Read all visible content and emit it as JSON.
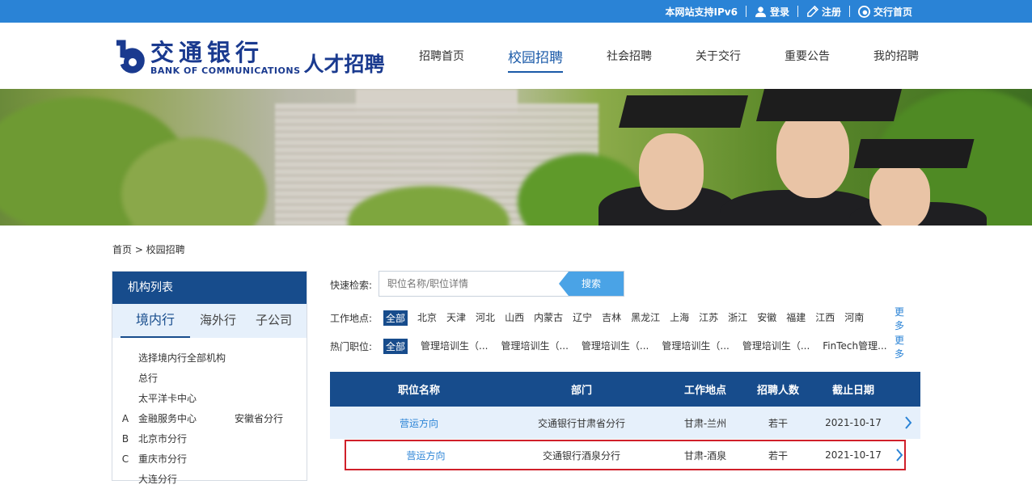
{
  "topbar": {
    "ipv6": "本网站支持IPv6",
    "login": "登录",
    "register": "注册",
    "home": "交行首页"
  },
  "logo": {
    "cn": "交通银行",
    "en": "BANK OF COMMUNICATIONS",
    "sub": "人才招聘"
  },
  "nav": [
    {
      "label": "招聘首页"
    },
    {
      "label": "校园招聘"
    },
    {
      "label": "社会招聘"
    },
    {
      "label": "关于交行"
    },
    {
      "label": "重要公告"
    },
    {
      "label": "我的招聘"
    }
  ],
  "breadcrumb": "首页 > 校园招聘",
  "sidebar": {
    "title": "机构列表",
    "tabs": [
      "境内行",
      "海外行",
      "子公司"
    ],
    "items": [
      {
        "letter": "",
        "name": "选择境内行全部机构",
        "extra": ""
      },
      {
        "letter": "",
        "name": "总行",
        "extra": ""
      },
      {
        "letter": "",
        "name": "太平洋卡中心",
        "extra": ""
      },
      {
        "letter": "A",
        "name": "金融服务中心",
        "extra": "安徽省分行"
      },
      {
        "letter": "B",
        "name": "北京市分行",
        "extra": ""
      },
      {
        "letter": "C",
        "name": "重庆市分行",
        "extra": ""
      },
      {
        "letter": "",
        "name": "大连分行",
        "extra": ""
      }
    ]
  },
  "search": {
    "label": "快速检索:",
    "placeholder": "职位名称/职位详情",
    "button": "搜索"
  },
  "filters": {
    "location_label": "工作地点:",
    "locations": [
      "全部",
      "北京",
      "天津",
      "河北",
      "山西",
      "内蒙古",
      "辽宁",
      "吉林",
      "黑龙江",
      "上海",
      "江苏",
      "浙江",
      "安徽",
      "福建",
      "江西",
      "河南"
    ],
    "position_label": "热门职位:",
    "positions": [
      "全部",
      "管理培训生（...",
      "管理培训生（...",
      "管理培训生（...",
      "管理培训生（...",
      "管理培训生（...",
      "FinTech管理..."
    ],
    "more": "更多"
  },
  "table": {
    "headers": [
      "职位名称",
      "部门",
      "工作地点",
      "招聘人数",
      "截止日期"
    ],
    "rows": [
      [
        "营运方向",
        "交通银行甘肃省分行",
        "甘肃-兰州",
        "若干",
        "2021-10-17"
      ],
      [
        "营运方向",
        "交通银行酒泉分行",
        "甘肃-酒泉",
        "若干",
        "2021-10-17"
      ]
    ]
  },
  "colors": {
    "primary": "#174c8c",
    "accent": "#2a83d6",
    "highlight": "#d0202a"
  }
}
